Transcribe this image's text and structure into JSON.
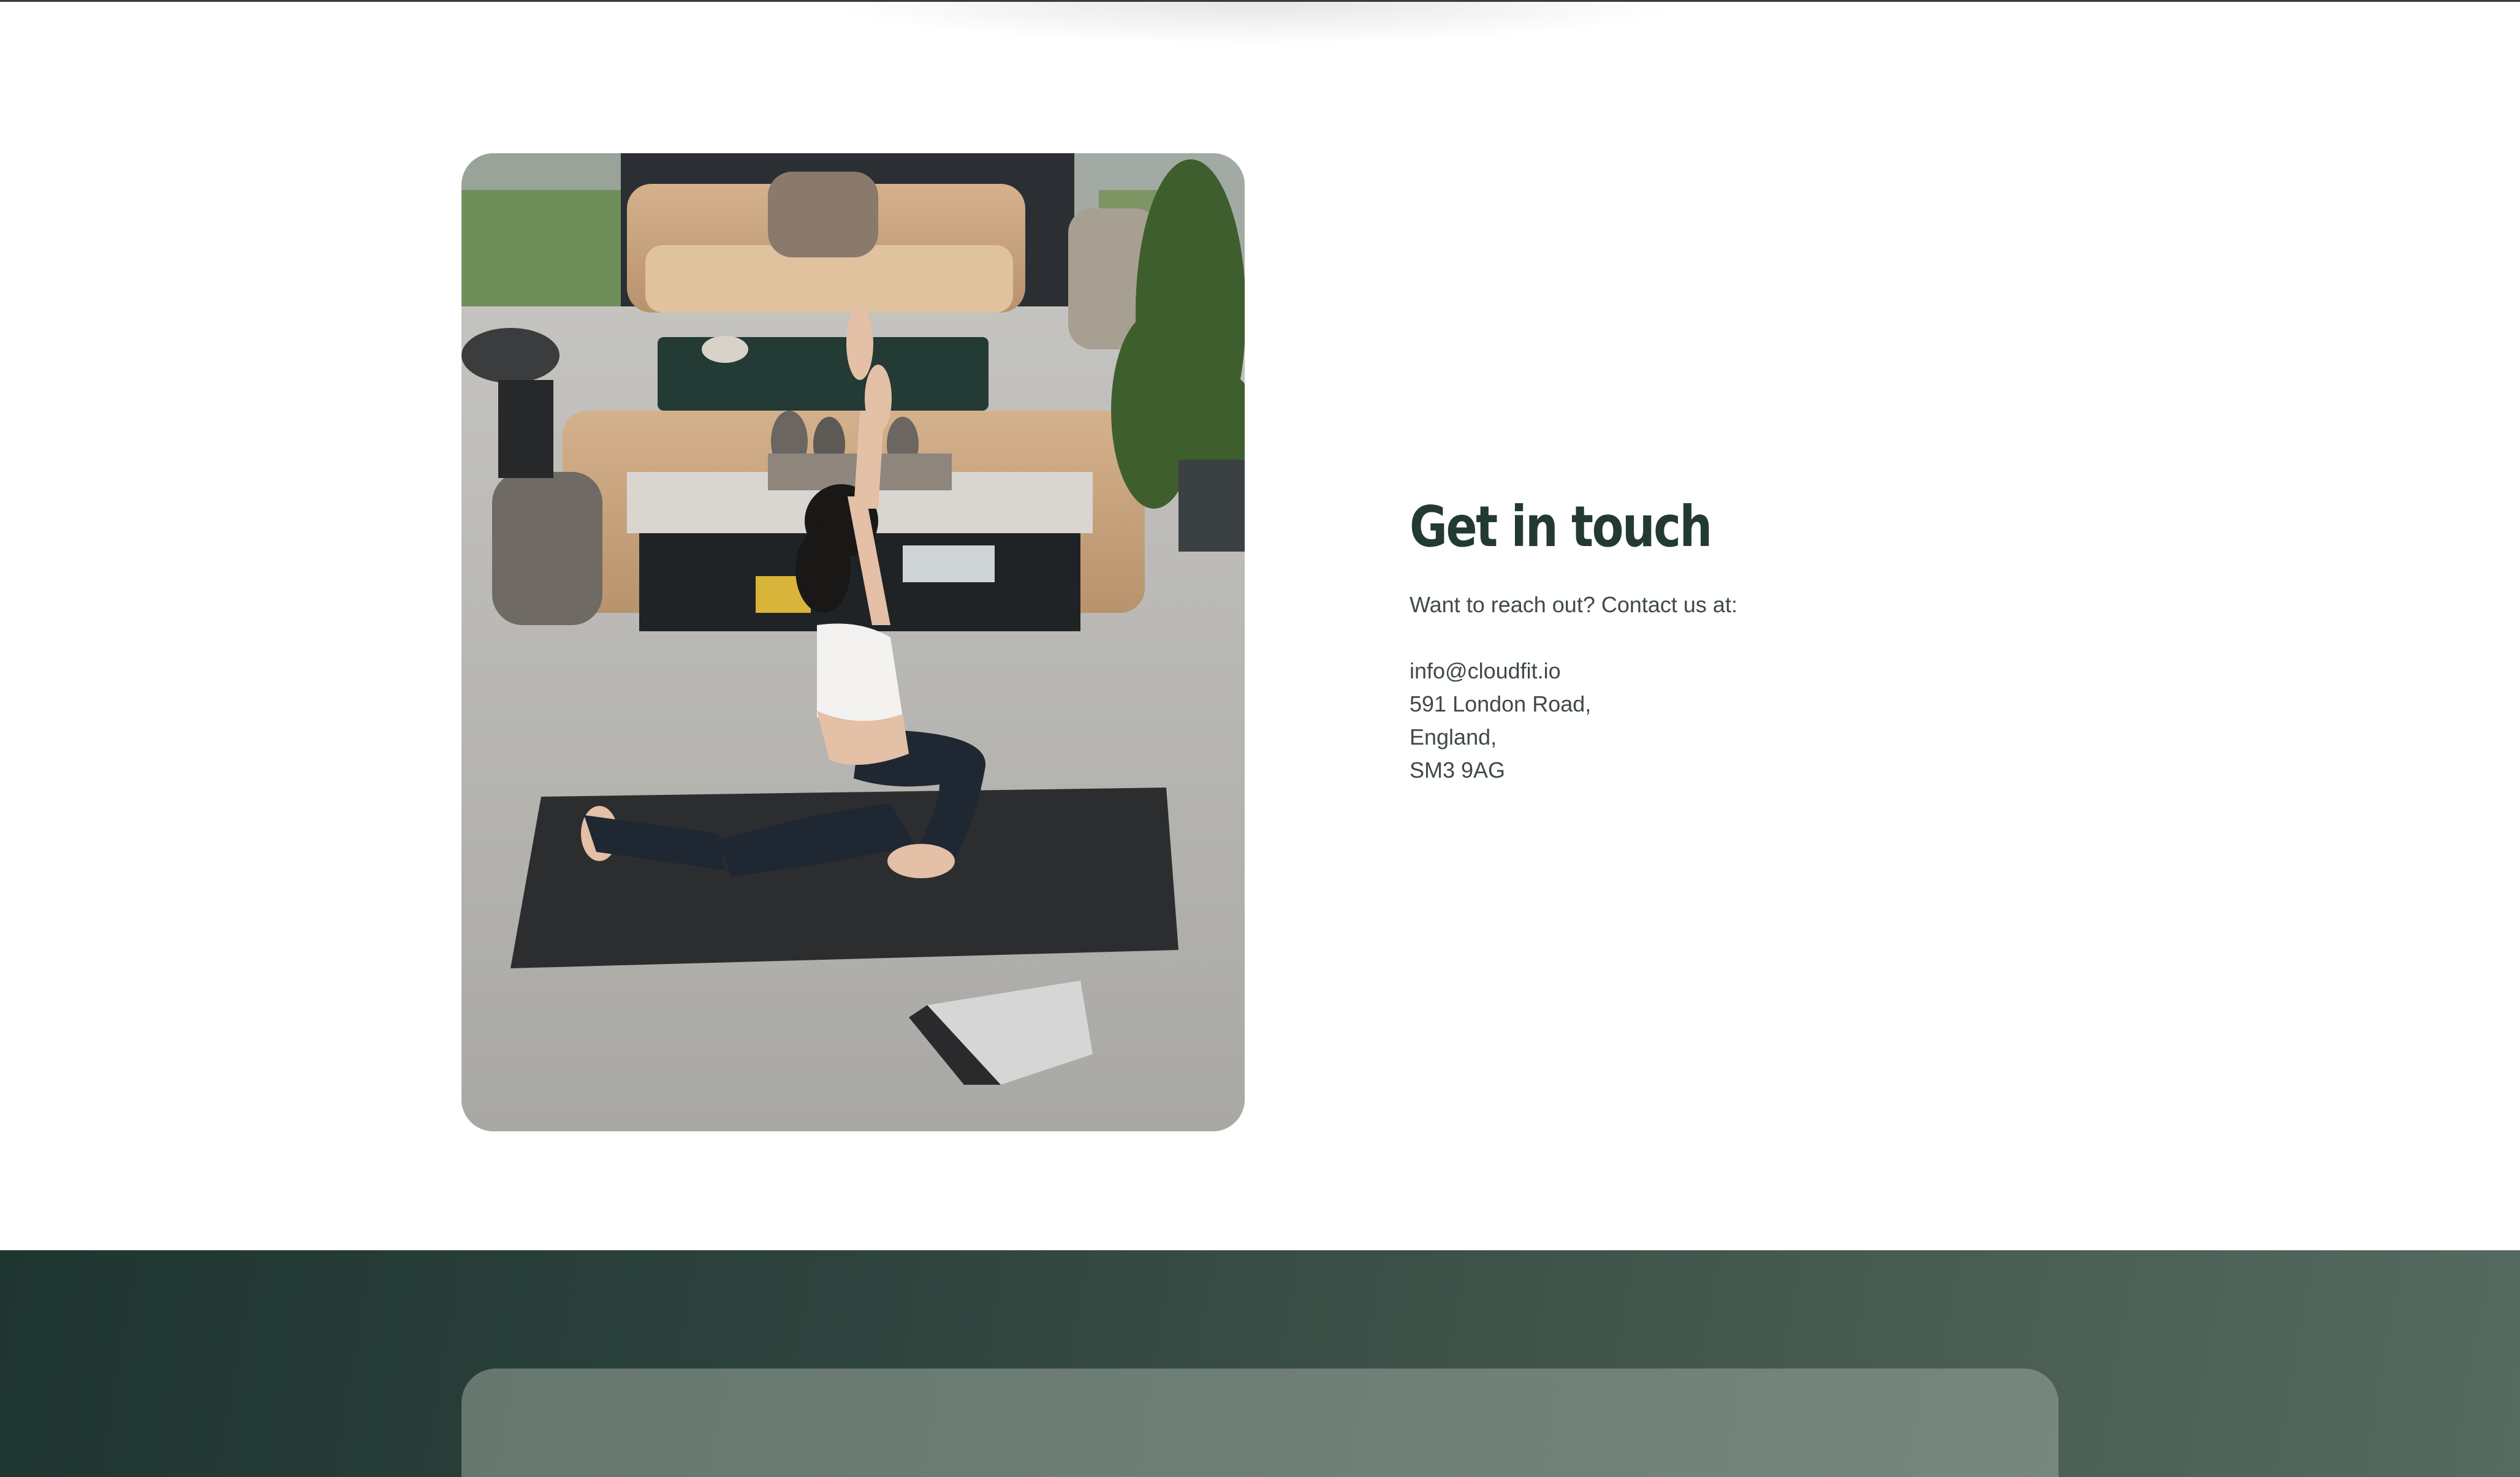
{
  "contact": {
    "title": "Get in touch",
    "intro": "Want to reach out? Contact us at:",
    "email": "info@cloudfit.io",
    "address_line1": "591 London Road,",
    "address_line2": "England,",
    "postcode": "SM3 9AG"
  },
  "colors": {
    "heading": "#233a33",
    "body_text": "#3f4a47",
    "band_start": "#1f3530",
    "band_end": "#566a61",
    "card": "#6f8078"
  },
  "icons": {
    "photo": "yoga-photo"
  }
}
